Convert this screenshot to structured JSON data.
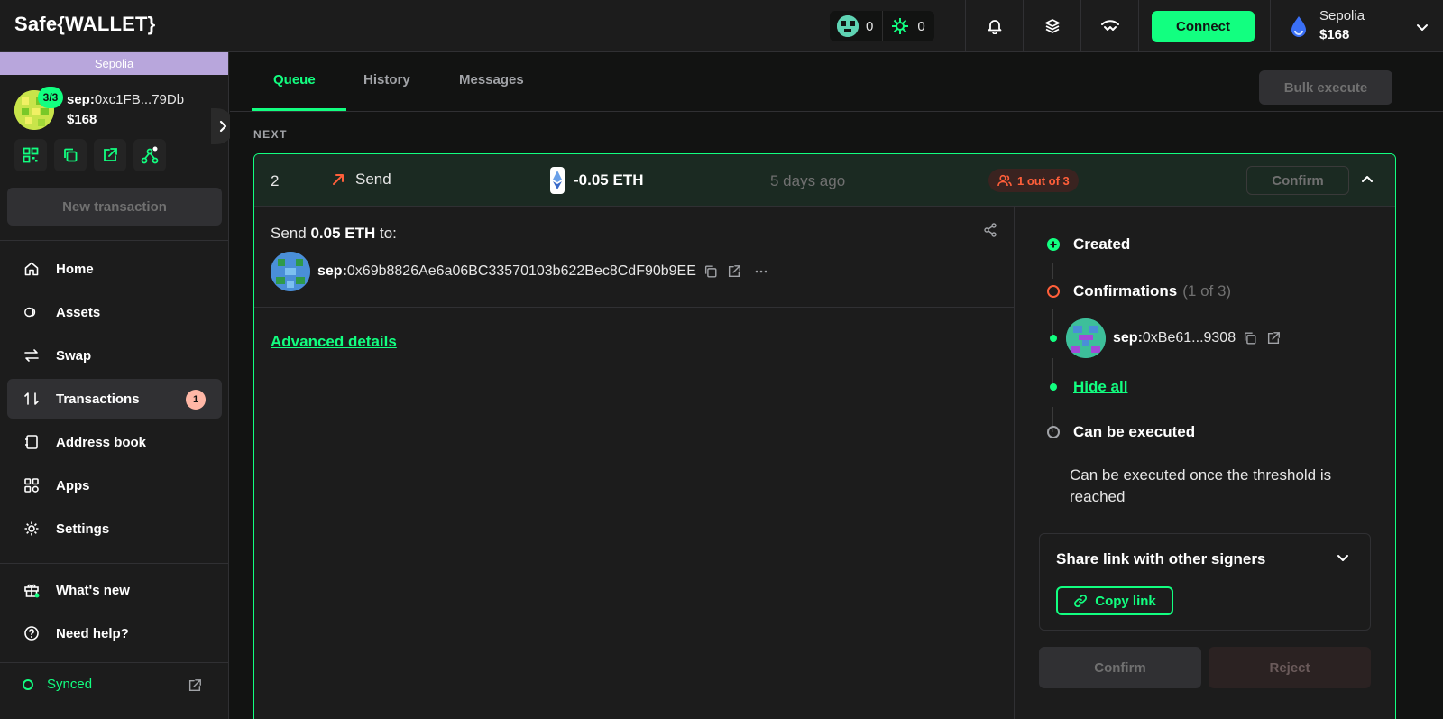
{
  "header": {
    "logo_text": "Safe{WALLET}",
    "counter_1": "0",
    "counter_2": "0",
    "connect_label": "Connect",
    "network_name": "Sepolia",
    "network_balance": "$168",
    "icons": [
      "bell-icon",
      "layers-icon",
      "walletconnect-icon",
      "chevron-down-icon"
    ]
  },
  "sidebar": {
    "chain_label": "Sepolia",
    "threshold": "3/3",
    "address_prefix": "sep:",
    "address": "0xc1FB...79Db",
    "balance": "$168",
    "new_tx_label": "New transaction",
    "nav": [
      {
        "label": "Home",
        "icon": "home-icon"
      },
      {
        "label": "Assets",
        "icon": "assets-icon"
      },
      {
        "label": "Swap",
        "icon": "swap-icon"
      },
      {
        "label": "Transactions",
        "icon": "transactions-icon",
        "badge": "1",
        "active": true
      },
      {
        "label": "Address book",
        "icon": "address-book-icon"
      },
      {
        "label": "Apps",
        "icon": "apps-icon"
      },
      {
        "label": "Settings",
        "icon": "settings-icon"
      }
    ],
    "whats_new": "What's new",
    "need_help": "Need help?",
    "synced": "Synced"
  },
  "main": {
    "tabs": [
      {
        "label": "Queue",
        "active": true
      },
      {
        "label": "History"
      },
      {
        "label": "Messages"
      }
    ],
    "bulk_execute": "Bulk execute",
    "section_label": "NEXT"
  },
  "transaction": {
    "nonce": "2",
    "type": "Send",
    "amount": "-0.05 ETH",
    "date": "5 days ago",
    "status": "1 out of 3",
    "confirm_label": "Confirm",
    "send_prefix": "Send",
    "send_amount": "0.05 ETH",
    "send_suffix": "to:",
    "recipient_prefix": "sep:",
    "recipient_address": "0x69b8826Ae6a06BC33570103b622Bec8CdF90b9EE",
    "advanced_details": "Advanced details",
    "steps": {
      "created": "Created",
      "confirmations": "Confirmations",
      "confirmations_count": "(1 of 3)",
      "signer_prefix": "sep:",
      "signer_address": "0xBe61...9308",
      "hide_all": "Hide all",
      "can_be_executed": "Can be executed",
      "execute_desc": "Can be executed once the threshold is reached"
    },
    "share_title": "Share link with other signers",
    "copy_link": "Copy link",
    "bottom_confirm": "Confirm",
    "bottom_reject": "Reject"
  },
  "colors": {
    "accent": "#12ff80",
    "background": "#121312",
    "panel": "#1c1c1c",
    "status_warning": "#ff5f3a",
    "chain_bar": "#b8a6dc"
  }
}
